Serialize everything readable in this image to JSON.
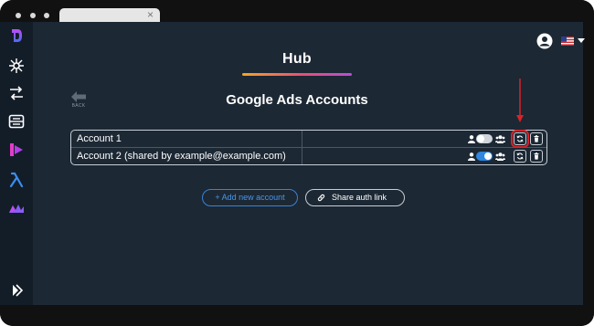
{
  "browser": {
    "tab_close_glyph": "×"
  },
  "sidebar": {
    "icons": [
      "logo-icon",
      "network-icon",
      "flow-arrows-icon",
      "dashboard-icon",
      "power-bi-icon",
      "lambda-icon",
      "make-icon",
      "expand-icon"
    ]
  },
  "header": {
    "language_flag": "us-flag-icon"
  },
  "page": {
    "title": "Hub",
    "back_label": "BACK",
    "section_title": "Google Ads Accounts"
  },
  "accounts": [
    {
      "name": "Account 1",
      "shared_toggle_on": false,
      "refresh_highlighted": true
    },
    {
      "name": "Account 2 (shared by example@example.com)",
      "shared_toggle_on": true,
      "refresh_highlighted": false
    }
  ],
  "actions": {
    "add_label": "+ Add new account",
    "share_label": "Share auth link"
  },
  "colors": {
    "accent_blue": "#2f87e0",
    "highlight_red": "#d6232a",
    "background": "#1c2834",
    "sidebar": "#131d28"
  }
}
